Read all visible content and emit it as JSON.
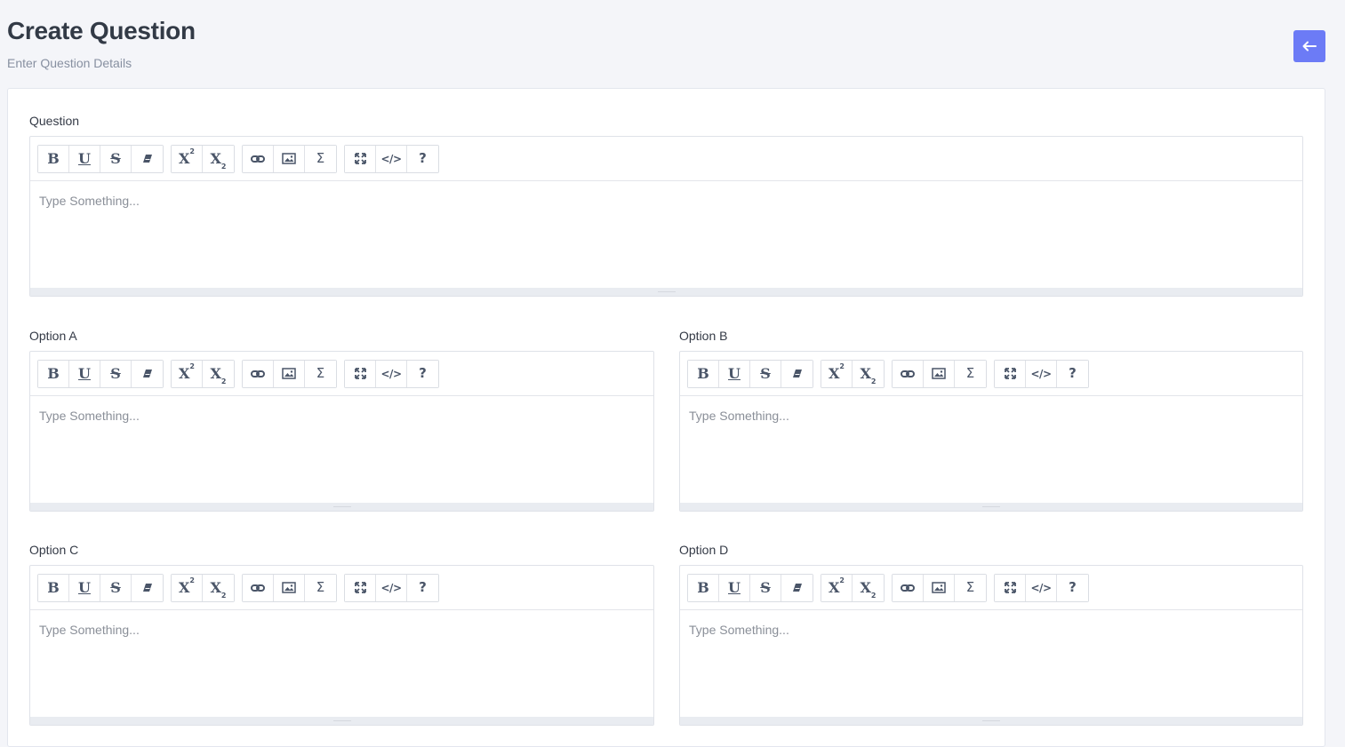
{
  "header": {
    "title": "Create Question",
    "subtitle": "Enter Question Details",
    "back_icon": "arrow-left-icon"
  },
  "accent_color": "#6c7bf6",
  "fields": {
    "question": {
      "label": "Question",
      "placeholder": "Type Something..."
    },
    "option_a": {
      "label": "Option A",
      "placeholder": "Type Something..."
    },
    "option_b": {
      "label": "Option B",
      "placeholder": "Type Something..."
    },
    "option_c": {
      "label": "Option C",
      "placeholder": "Type Something..."
    },
    "option_d": {
      "label": "Option D",
      "placeholder": "Type Something..."
    }
  },
  "toolbar_icons": [
    [
      "bold-icon",
      "underline-icon",
      "strikethrough-icon",
      "eraser-icon"
    ],
    [
      "superscript-icon",
      "subscript-icon"
    ],
    [
      "link-icon",
      "image-icon",
      "sigma-icon"
    ],
    [
      "fullscreen-icon",
      "code-view-icon",
      "help-icon"
    ]
  ]
}
